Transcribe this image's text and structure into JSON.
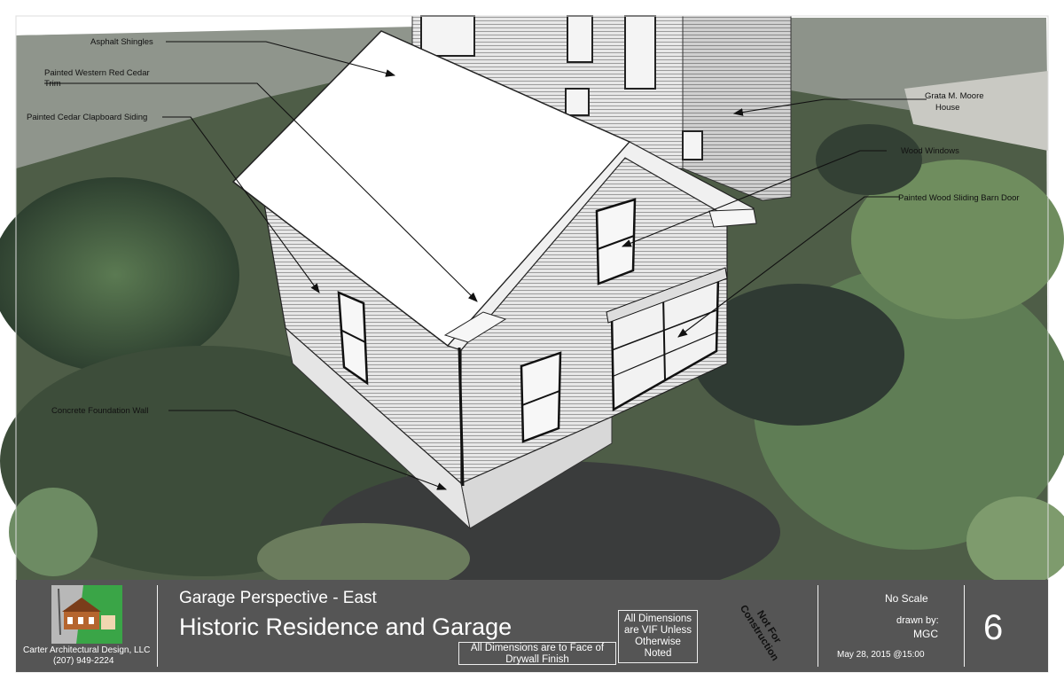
{
  "callouts": {
    "asphalt_shingles": "Asphalt Shingles",
    "red_cedar_trim_line1": "Painted Western Red Cedar",
    "red_cedar_trim_line2": "Trim",
    "clapboard_siding": "Painted Cedar Clapboard Siding",
    "moore_house_line1": "Grata M. Moore",
    "moore_house_line2": "House",
    "wood_windows": "Wood Windows",
    "barn_door": "Painted Wood Sliding Barn Door",
    "foundation_wall": "Concrete Foundation Wall"
  },
  "title_block": {
    "company_name": "Carter Architectural Design, LLC",
    "company_phone": "(207) 949-2224",
    "sheet_subtitle": "Garage Perspective - East",
    "project_title": "Historic Residence and Garage",
    "drywall_note_line1": "All Dimensions are to Face of",
    "drywall_note_line2": "Drywall Finish",
    "vif_note_line1": "All Dimensions",
    "vif_note_line2": "are VIF Unless",
    "vif_note_line3": "Otherwise",
    "vif_note_line4": "Noted",
    "stamp_line1": "Not For",
    "stamp_line2": "Construction",
    "scale": "No Scale",
    "drawn_by_label": "drawn by:",
    "drawn_by": "MGC",
    "date": "May 28, 2015 @15:00",
    "sheet_number": "6"
  },
  "colors": {
    "title_block_bg": "#555555",
    "aerial_green": "#4f6a45",
    "siding": "#e6e6e6",
    "roof": "#ffffff"
  }
}
